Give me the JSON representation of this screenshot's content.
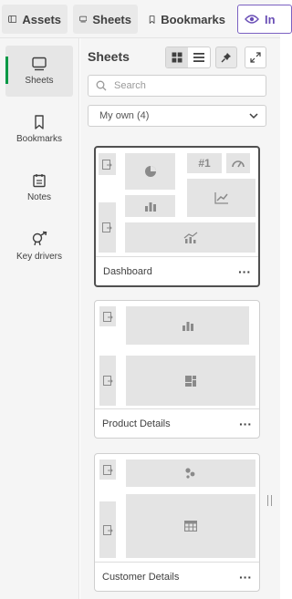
{
  "top_tabs": [
    {
      "label": "Assets",
      "icon": "panel-icon"
    },
    {
      "label": "Sheets",
      "icon": "sheet-icon"
    },
    {
      "label": "Bookmarks",
      "icon": "bookmark-icon"
    },
    {
      "label": "In",
      "icon": "eye-icon"
    }
  ],
  "rail": [
    {
      "label": "Sheets",
      "icon": "sheet-icon",
      "active": true
    },
    {
      "label": "Bookmarks",
      "icon": "bookmark-icon"
    },
    {
      "label": "Notes",
      "icon": "notes-icon"
    },
    {
      "label": "Key drivers",
      "icon": "key-drivers-icon"
    }
  ],
  "panel": {
    "title": "Sheets",
    "view_toggle": [
      "grid-view-icon",
      "list-view-icon"
    ],
    "search_placeholder": "Search",
    "filter_value": "My own (4)",
    "kpi_glyph": "#1"
  },
  "sheets": [
    {
      "name": "Dashboard",
      "more": "···",
      "selected": true
    },
    {
      "name": "Product Details",
      "more": "···"
    },
    {
      "name": "Customer Details",
      "more": "···"
    }
  ],
  "colors": {
    "accent_green": "#009845",
    "insight_purple": "#6a4fb6",
    "panel_bg": "#f5f5f5",
    "placeholder_block": "#e4e4e4"
  }
}
